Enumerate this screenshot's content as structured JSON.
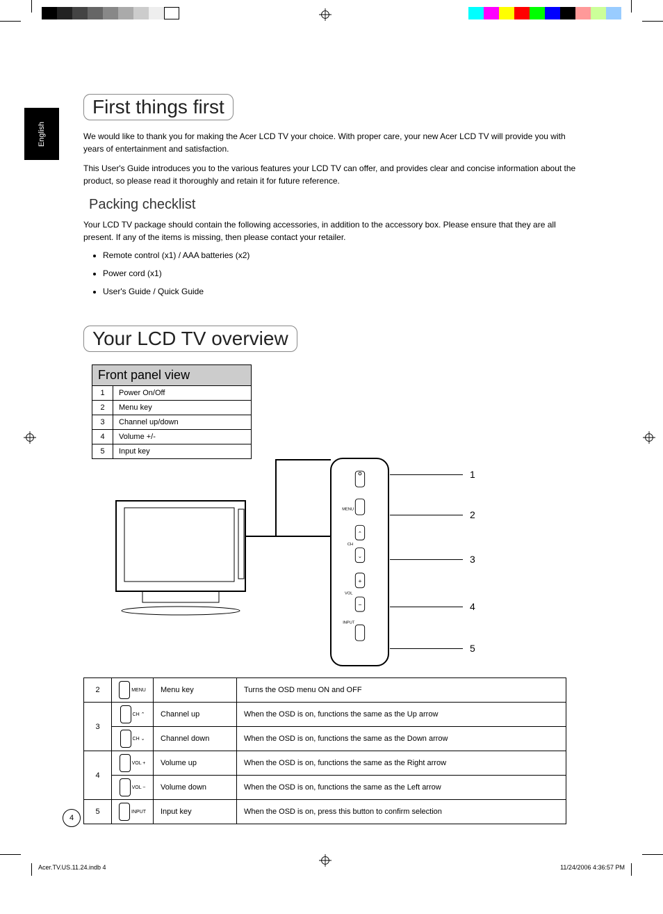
{
  "language_tab": "English",
  "section1": {
    "title": "First things first",
    "para1": "We would like to thank you for making the Acer LCD TV your choice. With proper care, your new Acer LCD TV will provide you with years of entertainment and satisfaction.",
    "para2": "This User's Guide introduces you to the various features your LCD TV can offer, and provides clear and concise information about the product, so please read it thoroughly and retain it for future reference."
  },
  "packing": {
    "title": "Packing checklist",
    "intro": "Your LCD TV package should contain the following accessories, in addition to the accessory box. Please ensure that they are all present. If any of the items is missing, then please contact your retailer.",
    "items": [
      "Remote control (x1) / AAA batteries (x2)",
      "Power cord (x1)",
      "User's Guide / Quick Guide"
    ]
  },
  "section2": {
    "title": "Your LCD TV overview"
  },
  "front_panel": {
    "header": "Front panel view",
    "rows": [
      {
        "n": "1",
        "label": "Power On/Off"
      },
      {
        "n": "2",
        "label": "Menu key"
      },
      {
        "n": "3",
        "label": "Channel up/down"
      },
      {
        "n": "4",
        "label": "Volume +/-"
      },
      {
        "n": "5",
        "label": "Input key"
      }
    ]
  },
  "callouts": [
    "1",
    "2",
    "3",
    "4",
    "5"
  ],
  "functions": {
    "menu": {
      "n": "2",
      "btn": "MENU",
      "name": "Menu key",
      "desc": "Turns the OSD menu ON and OFF"
    },
    "ch": {
      "n": "3",
      "btn_up": "CH ⌃",
      "btn_dn": "CH ⌄",
      "name_up": "Channel up",
      "name_dn": "Channel down",
      "desc_up": "When the OSD is on, functions the same as the Up arrow",
      "desc_dn": "When the OSD is on, functions the same as the Down arrow"
    },
    "vol": {
      "n": "4",
      "btn_up": "VOL +",
      "btn_dn": "VOL −",
      "name_up": "Volume up",
      "name_dn": "Volume down",
      "desc_up": "When the OSD is on, functions the same as the Right arrow",
      "desc_dn": "When the OSD is on, functions the same as the Left arrow"
    },
    "input": {
      "n": "5",
      "btn": "INPUT",
      "name": "Input key",
      "desc": "When the OSD is on, press this button to confirm selection"
    }
  },
  "page_number": "4",
  "footer": {
    "filename": "Acer.TV.US.11.24.indb   4",
    "timestamp": "11/24/2006   4:36:57 PM"
  },
  "panel_labels": {
    "menu": "MENU",
    "ch": "CH",
    "vol": "VOL",
    "input": "INPUT"
  }
}
